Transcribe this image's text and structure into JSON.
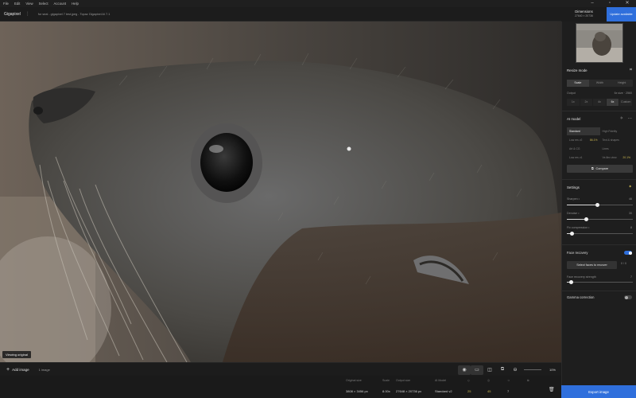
{
  "menu": [
    "File",
    "Edit",
    "View",
    "Select",
    "Account",
    "Help"
  ],
  "app": {
    "name": "Gigapixel",
    "file_path": "fur seal - gigapixel 7 test.jpeg - Topaz Gigapixel AI 7.1"
  },
  "header": {
    "dimensions_label": "Dimensions",
    "dimensions_value": "27640 × 20736",
    "update_label": "Update available"
  },
  "viewer": {
    "viewing_label": "Viewing original"
  },
  "imagebar": {
    "add_label": "Add image",
    "count_label": "1 image",
    "zoom": "10%"
  },
  "status": {
    "headers": [
      "Original size",
      "Scale",
      "Output size",
      "AI Model"
    ],
    "values": [
      "3808 × 3456 px",
      "8.00x",
      "27648 × 20736 px",
      "Standard v2",
      "25",
      "45",
      "7"
    ]
  },
  "panel": {
    "resize_mode": "Resize mode",
    "resize_tabs": [
      "Scale",
      "Width",
      "Height"
    ],
    "output_label": "Output",
    "output_value": "6x size · 2560",
    "scale_opts": [
      "1x",
      "2x",
      "4x",
      "6x",
      "Custom"
    ],
    "ai_model": "AI model",
    "models": [
      [
        {
          "n": "Standard",
          "v": ""
        },
        {
          "n": "High Fidelity",
          "v": ""
        }
      ],
      [
        {
          "n": "Low res v2",
          "v": "86.1%"
        },
        {
          "n": "Text & shapes",
          "v": ""
        }
      ],
      [
        {
          "n": "Art & CG",
          "v": ""
        },
        {
          "n": "Lines",
          "v": ""
        }
      ],
      [
        {
          "n": "Low res v1",
          "v": ""
        },
        {
          "n": "Ve-flex view",
          "v": "20.1%"
        }
      ]
    ],
    "compare": "Compare",
    "settings": "Settings",
    "sharpen_label": "Sharpen",
    "sharpen_value": "46",
    "denoise_label": "Denoise",
    "denoise_value": "30",
    "fix_label": "Fix compression",
    "fix_value": "8",
    "face_recovery": "Face recovery",
    "select_faces": "Select faces to recover",
    "faces_count": "0 / 0",
    "face_strength_label": "Face recovery strength",
    "face_strength_value": "7",
    "gamma": "Gamma correction"
  },
  "export": {
    "label": "Export image"
  },
  "colors": {
    "accent": "#2f6fdc"
  },
  "levels": {
    "sharpen": 0.46,
    "denoise": 0.3,
    "fix": 0.08,
    "face_strength": 0.07
  }
}
